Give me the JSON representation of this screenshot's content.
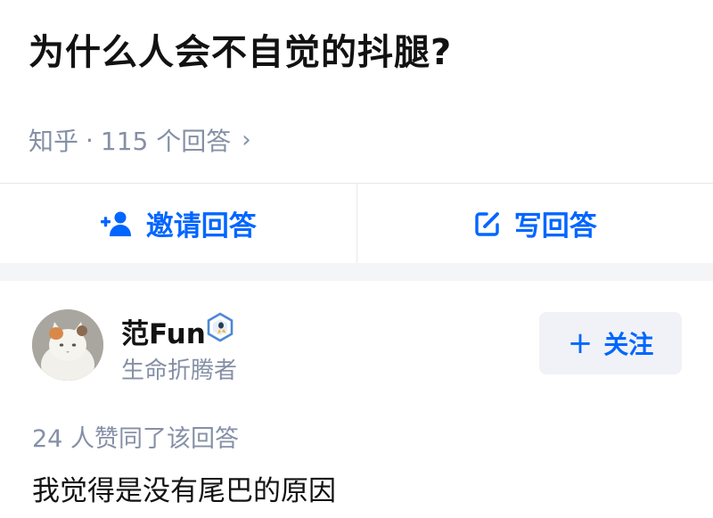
{
  "question": {
    "title": "为什么人会不自觉的抖腿?",
    "source": "知乎",
    "separator": "·",
    "answer_count": "115 个回答",
    "chevron": "›"
  },
  "actions": {
    "invite_label": "邀请回答",
    "invite_icon": "add-person-icon",
    "write_label": "写回答",
    "write_icon": "edit-icon"
  },
  "answer": {
    "author_name": "范Fun",
    "author_badge_icon": "verified-badge-icon",
    "author_bio": "生命折腾者",
    "follow_plus": "+",
    "follow_label": "关注",
    "vote_text": "24 人赞同了该回答",
    "content": "我觉得是没有尾巴的原因"
  },
  "colors": {
    "accent": "#0066ff",
    "muted_text": "#8590a6",
    "divider": "#f4f5f7",
    "follow_bg": "#f0f2f7"
  }
}
